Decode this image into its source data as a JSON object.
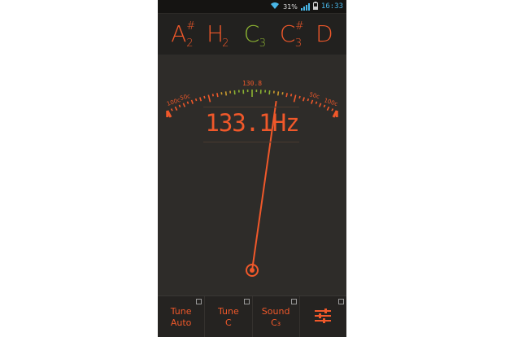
{
  "status": {
    "battery": "31%",
    "time": "16:33"
  },
  "notes": [
    {
      "letter": "A",
      "sharp": "#",
      "octave": "2",
      "active": false
    },
    {
      "letter": "H",
      "sharp": "",
      "octave": "2",
      "active": false
    },
    {
      "letter": "C",
      "sharp": "",
      "octave": "3",
      "active": true
    },
    {
      "letter": "C",
      "sharp": "#",
      "octave": "3",
      "active": false
    },
    {
      "letter": "D",
      "sharp": "",
      "octave": "",
      "active": false
    }
  ],
  "gauge": {
    "target_label": "130.8",
    "left_labels": [
      "100c",
      "50c"
    ],
    "right_labels": [
      "50c",
      "100c"
    ],
    "needle_cents": 29
  },
  "frequency": "133.1Hz",
  "toolbar": {
    "tune_auto": {
      "line1": "Tune",
      "line2": "Auto"
    },
    "tune_c": {
      "line1": "Tune",
      "line2": "C"
    },
    "sound": {
      "line1": "Sound",
      "line2": "C₃"
    }
  },
  "colors": {
    "accent": "#f0582a",
    "in_tune": "#8cb332",
    "background": "#2e2c29"
  }
}
